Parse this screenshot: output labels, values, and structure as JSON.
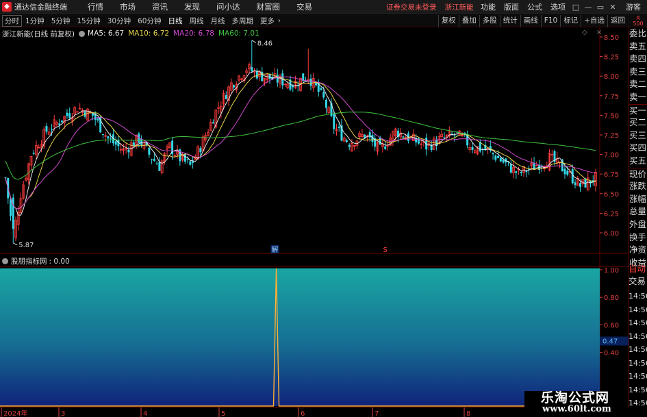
{
  "app": {
    "title": "通达信金融终端",
    "menu": [
      "行情",
      "市场",
      "资讯",
      "发现",
      "问小达",
      "财富圈",
      "交易"
    ],
    "notice": "证券交易未登录",
    "stock_name": "浙江新能",
    "right_menu": [
      "功能",
      "版面",
      "公式",
      "选项"
    ],
    "window_buttons": [
      "□",
      "—",
      "▭",
      "✕"
    ],
    "guest": "游客"
  },
  "periods": [
    "分时",
    "1分钟",
    "5分钟",
    "15分钟",
    "30分钟",
    "60分钟",
    "日线",
    "周线",
    "月线",
    "多周期",
    "更多"
  ],
  "active_period": "日线",
  "tools": [
    "复权",
    "叠加",
    "多股",
    "统计",
    "画线",
    "F10",
    "标记",
    "+自选",
    "返回"
  ],
  "rtag": {
    "line1": "R",
    "line2": "500"
  },
  "main_panel": {
    "caption": "浙江新能(日线 前复权)",
    "ma": [
      {
        "label": "MA5: 6.67",
        "color": "#e8e8e8"
      },
      {
        "label": "MA10: 6.72",
        "color": "#e8d44a"
      },
      {
        "label": "MA20: 6.78",
        "color": "#d04ad0"
      },
      {
        "label": "MA60: 7.01",
        "color": "#3fc43f"
      }
    ],
    "high_label": "8.46",
    "low_label": "5.87",
    "marker_jie": "解",
    "marker_s": "S",
    "price_ticks": [
      "8.50",
      "8.25",
      "8.00",
      "7.75",
      "7.50",
      "7.25",
      "7.00",
      "6.75",
      "6.50",
      "6.25",
      "6.00"
    ]
  },
  "order_panel": [
    "委比",
    "卖五",
    "卖四",
    "卖三",
    "卖二",
    "卖一",
    "买一",
    "买二",
    "买三",
    "买四",
    "买五",
    "现价",
    "涨跌",
    "涨幅",
    "总量",
    "外盘",
    "换手",
    "净资",
    "收益"
  ],
  "auto_trade": [
    "自动",
    "交易"
  ],
  "tick_times": [
    "14:56",
    "14:56",
    "14:56",
    "14:56",
    "14:56",
    "14:56",
    "14:56",
    "14:56",
    "14:56"
  ],
  "indicator": {
    "name": "股朋指标网",
    "value": ": 0.00",
    "ticks": [
      "1.00",
      "0.80",
      "0.60",
      "0.40"
    ],
    "cursor_value": "0.47"
  },
  "x_axis": [
    "2024年",
    "3",
    "4",
    "5",
    "6",
    "7",
    "8"
  ],
  "watermark": {
    "title": "乐淘公式网",
    "url": "www.60lt.com"
  },
  "colors": {
    "up": "#ff3c3c",
    "down": "#33d6e6",
    "grid": "#6a0000",
    "axis_text": "#e04040"
  },
  "chart_data": {
    "type": "candlestick",
    "title": "浙江新能(日线 前复权)",
    "ylim": [
      5.8,
      8.6
    ],
    "series": [
      {
        "name": "MA5",
        "last": 6.67
      },
      {
        "name": "MA10",
        "last": 6.72
      },
      {
        "name": "MA20",
        "last": 6.78
      },
      {
        "name": "MA60",
        "last": 7.01
      }
    ],
    "annotations": [
      {
        "label": "8.46",
        "kind": "high"
      },
      {
        "label": "5.87",
        "kind": "low"
      }
    ],
    "indicator": {
      "name": "股朋指标网",
      "ylim": [
        0,
        1
      ],
      "value": 0.0,
      "spike": 1.0
    }
  }
}
